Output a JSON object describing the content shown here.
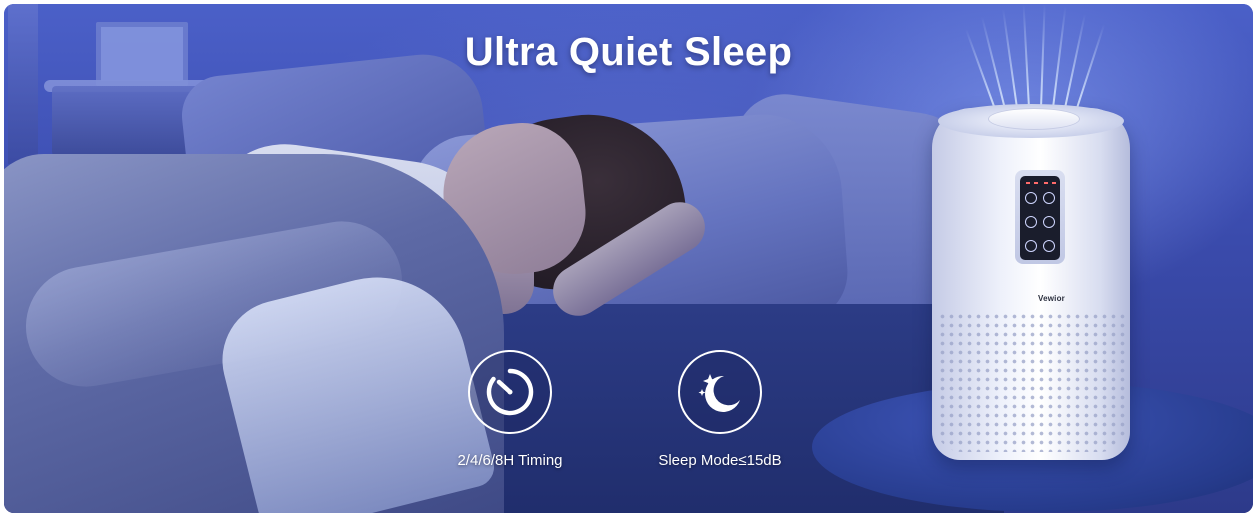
{
  "headline": "Ultra Quiet Sleep",
  "features": [
    {
      "label": "2/4/6/8H Timing",
      "icon": "timer-icon"
    },
    {
      "label": "Sleep Mode≤15dB",
      "icon": "moon-stars-icon"
    }
  ],
  "product": {
    "brand": "Vewior"
  },
  "colors": {
    "accent": "#ffffff",
    "background": "#3c4db0"
  }
}
